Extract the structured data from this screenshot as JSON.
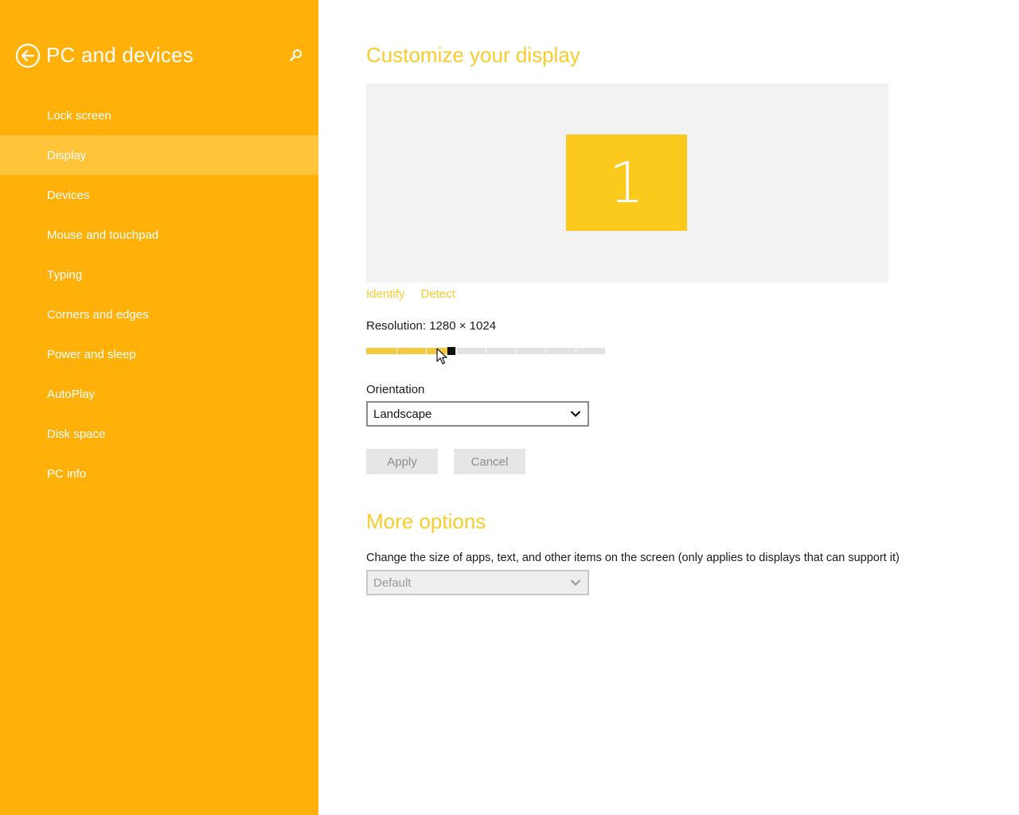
{
  "sidebar": {
    "title": "PC and devices",
    "items": [
      {
        "label": "Lock screen",
        "selected": false
      },
      {
        "label": "Display",
        "selected": true
      },
      {
        "label": "Devices",
        "selected": false
      },
      {
        "label": "Mouse and touchpad",
        "selected": false
      },
      {
        "label": "Typing",
        "selected": false
      },
      {
        "label": "Corners and edges",
        "selected": false
      },
      {
        "label": "Power and sleep",
        "selected": false
      },
      {
        "label": "AutoPlay",
        "selected": false
      },
      {
        "label": "Disk space",
        "selected": false
      },
      {
        "label": "PC info",
        "selected": false
      }
    ]
  },
  "main": {
    "title": "Customize your display",
    "monitor_number": "1",
    "links": {
      "identify": "Identify",
      "detect": "Detect"
    },
    "resolution_label": "Resolution: 1280 × 1024",
    "resolution_slider": {
      "steps": 8,
      "position_fraction": 0.34
    },
    "orientation_label": "Orientation",
    "orientation_value": "Landscape",
    "apply_label": "Apply",
    "cancel_label": "Cancel",
    "more_options_title": "More options",
    "scale_description": "Change the size of apps, text, and other items on the screen (only applies to displays that can support it)",
    "scale_value": "Default"
  },
  "colors": {
    "sidebar_bg": "#ffb10a",
    "sidebar_selected": "#ffc43a",
    "accent": "#f9cc2c",
    "monitor": "#fcca1c",
    "slider_fill": "#f5c842"
  }
}
